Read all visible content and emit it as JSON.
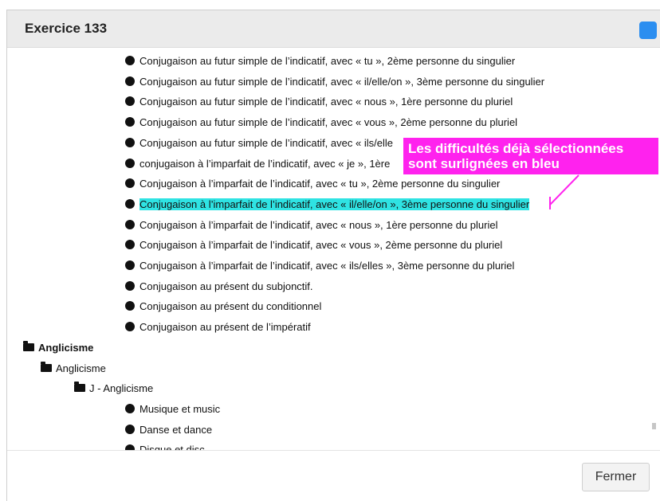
{
  "dialog": {
    "title": "Exercice 133",
    "close_label": "Fermer"
  },
  "colors": {
    "header_button": "#2b8ef0",
    "selected_highlight": "#2fe3e3",
    "callout": "#ff22ee"
  },
  "list": {
    "conjugation_items": [
      {
        "label": "Conjugaison au futur simple de l’indicatif, avec « tu », 2ème personne du singulier",
        "selected": false
      },
      {
        "label": "Conjugaison au futur simple de l’indicatif, avec « il/elle/on », 3ème personne du singulier",
        "selected": false
      },
      {
        "label": "Conjugaison au futur simple de l’indicatif, avec « nous », 1ère personne du pluriel",
        "selected": false
      },
      {
        "label": "Conjugaison au futur simple de l’indicatif, avec « vous », 2ème personne du pluriel",
        "selected": false
      },
      {
        "label": "Conjugaison au futur simple de l’indicatif, avec « ils/elle",
        "selected": false
      },
      {
        "label": "conjugaison à l’imparfait de l’indicatif, avec « je », 1ère",
        "selected": false
      },
      {
        "label": "Conjugaison à l’imparfait de l’indicatif, avec « tu », 2ème personne du singulier",
        "selected": false
      },
      {
        "label": "Conjugaison à l’imparfait de l’indicatif, avec « il/elle/on », 3ème personne du singulier",
        "selected": true
      },
      {
        "label": "Conjugaison à l’imparfait de l’indicatif, avec « nous », 1ère personne du pluriel",
        "selected": false
      },
      {
        "label": "Conjugaison à l’imparfait de l’indicatif, avec « vous », 2ème personne du pluriel",
        "selected": false
      },
      {
        "label": "Conjugaison à l’imparfait de l’indicatif, avec « ils/elles », 3ème personne du pluriel",
        "selected": false
      },
      {
        "label": "Conjugaison au présent du subjonctif.",
        "selected": false
      },
      {
        "label": "Conjugaison au présent du conditionnel",
        "selected": false
      },
      {
        "label": "Conjugaison au présent de l’impératif",
        "selected": false
      }
    ],
    "category": "Anglicisme",
    "subcategory": "Anglicisme",
    "subsubcategory": "J - Anglicisme",
    "anglicism_items": [
      {
        "label": "Musique et music",
        "selected": false
      },
      {
        "label": "Danse et dance",
        "selected": false
      },
      {
        "label": "Disque et disc",
        "selected": false
      }
    ]
  },
  "callout": {
    "line1": "Les difficultés déjà sélectionnées",
    "line2": "sont surlignées en bleu"
  }
}
